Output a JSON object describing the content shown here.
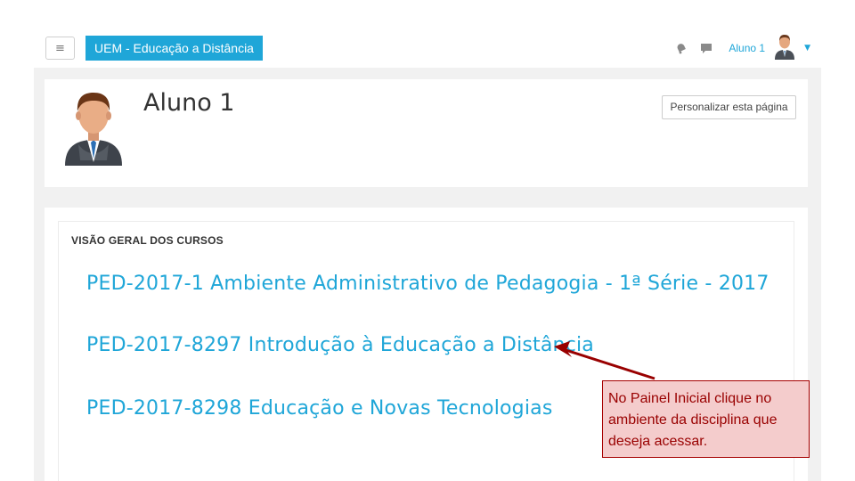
{
  "navbar": {
    "menu_icon": "hamburger-icon",
    "brand": "UEM - Educação a Distância",
    "notification_icon": "bell-icon",
    "messages_icon": "chat-icon",
    "user_name": "Aluno 1",
    "user_menu_icon": "chevron-down-icon"
  },
  "header": {
    "title": "Aluno 1",
    "customize_button": "Personalizar esta página"
  },
  "course_overview": {
    "title": "VISÃO GERAL DOS CURSOS",
    "courses": [
      {
        "name": "PED-2017-1 Ambiente Administrativo de Pedagogia - 1ª Série - 2017"
      },
      {
        "name": "PED-2017-8297 Introdução à Educação a Distância"
      },
      {
        "name": "PED-2017-8298 Educação e Novas Tecnologias"
      }
    ]
  },
  "callout": {
    "text": "No Painel Inicial clique no ambiente da disciplina que deseja acessar."
  },
  "colors": {
    "accent": "#1fa6d8",
    "callout_bg": "#f4cccc",
    "callout_text": "#990000"
  }
}
